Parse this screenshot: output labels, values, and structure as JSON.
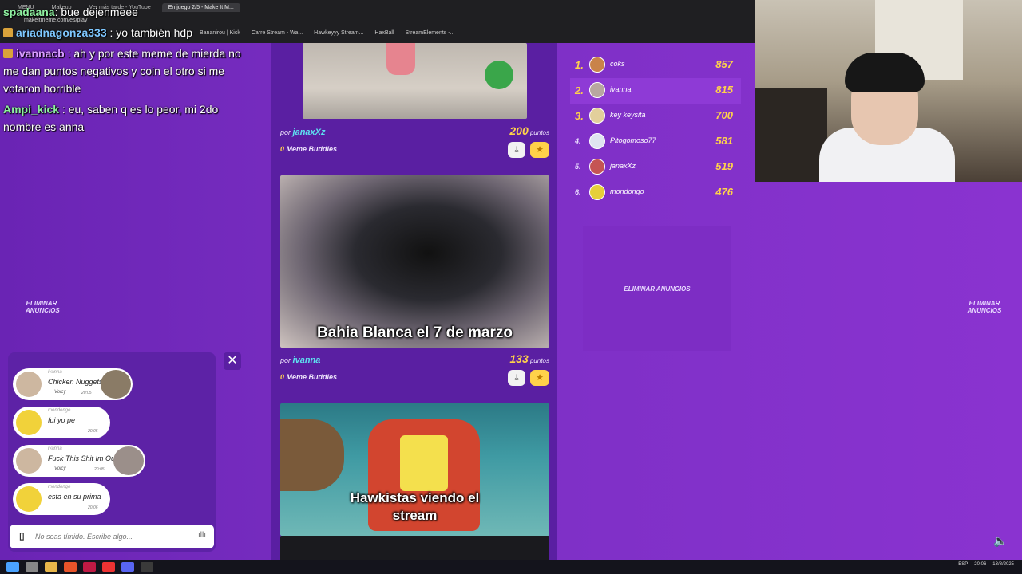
{
  "browser": {
    "tabs": [
      "MENU",
      "Makeup",
      "Ver más tarde - YouTube",
      "En juego 2/5 - Make It M..."
    ],
    "address": "makeitmeme.com/es/play",
    "bookmarks": [
      "Bananirou | Kick",
      "Carre Stream - Wa...",
      "Hawkeyyy Stream...",
      "HaxBall",
      "StreamElements -..."
    ]
  },
  "stream_chat": [
    {
      "user": "spadaana",
      "text": ": bue dejenmeee"
    },
    {
      "user": "ariadnagonza333",
      "text": " : yo también hdp"
    },
    {
      "user": "ivannacb",
      "text": " : ah y por este meme de mierda no"
    },
    {
      "user": "",
      "text": "me dan puntos negativos y coin el otro si me"
    },
    {
      "user": "",
      "text": "votaron horrible"
    },
    {
      "user": "Ampi_kick",
      "text": " : eu, saben q es lo peor, mi 2do"
    },
    {
      "user": "",
      "text": "nombre es anna"
    }
  ],
  "ads": {
    "remove_label": "ELIMINAR ANUNCIOS"
  },
  "feed": {
    "by_prefix": "por",
    "points_suffix": "puntos",
    "buddies_suffix": "Meme Buddies",
    "memes": [
      {
        "author": "janaxXz",
        "points": "200",
        "buddies": "0",
        "caption": ""
      },
      {
        "author": "ivanna",
        "points": "133",
        "buddies": "0",
        "caption": "Bahia Blanca el 7 de marzo"
      },
      {
        "author": "",
        "points": "",
        "buddies": "",
        "caption": "Hawkistas viendo el stream"
      }
    ]
  },
  "leaderboard": [
    {
      "rank": "1.",
      "name": "coks",
      "score": "857"
    },
    {
      "rank": "2.",
      "name": "ivanna",
      "score": "815"
    },
    {
      "rank": "3.",
      "name": "key keysita",
      "score": "700"
    },
    {
      "rank": "4.",
      "name": "Pitogomoso77",
      "score": "581"
    },
    {
      "rank": "5.",
      "name": "janaxXz",
      "score": "519"
    },
    {
      "rank": "6.",
      "name": "mondongo",
      "score": "476"
    }
  ],
  "game_chat": {
    "messages": [
      {
        "user": "ivanna",
        "text": "Chicken Nuggets",
        "voicy": "Voicy",
        "time": "20:05"
      },
      {
        "user": "mondongo",
        "text": "fui yo pe",
        "voicy": "",
        "time": "20:05"
      },
      {
        "user": "ivanna",
        "text": "Fuck This Shit Im Out",
        "voicy": "Voicy",
        "time": "20:05"
      },
      {
        "user": "mondongo",
        "text": "esta en su prima",
        "voicy": "",
        "time": "20:06"
      }
    ],
    "input_placeholder": "No seas tímido. Escribe algo...",
    "close_label": "✕"
  },
  "taskbar": {
    "lang": "ESP",
    "time": "20:06",
    "date": "13/8/2025"
  }
}
